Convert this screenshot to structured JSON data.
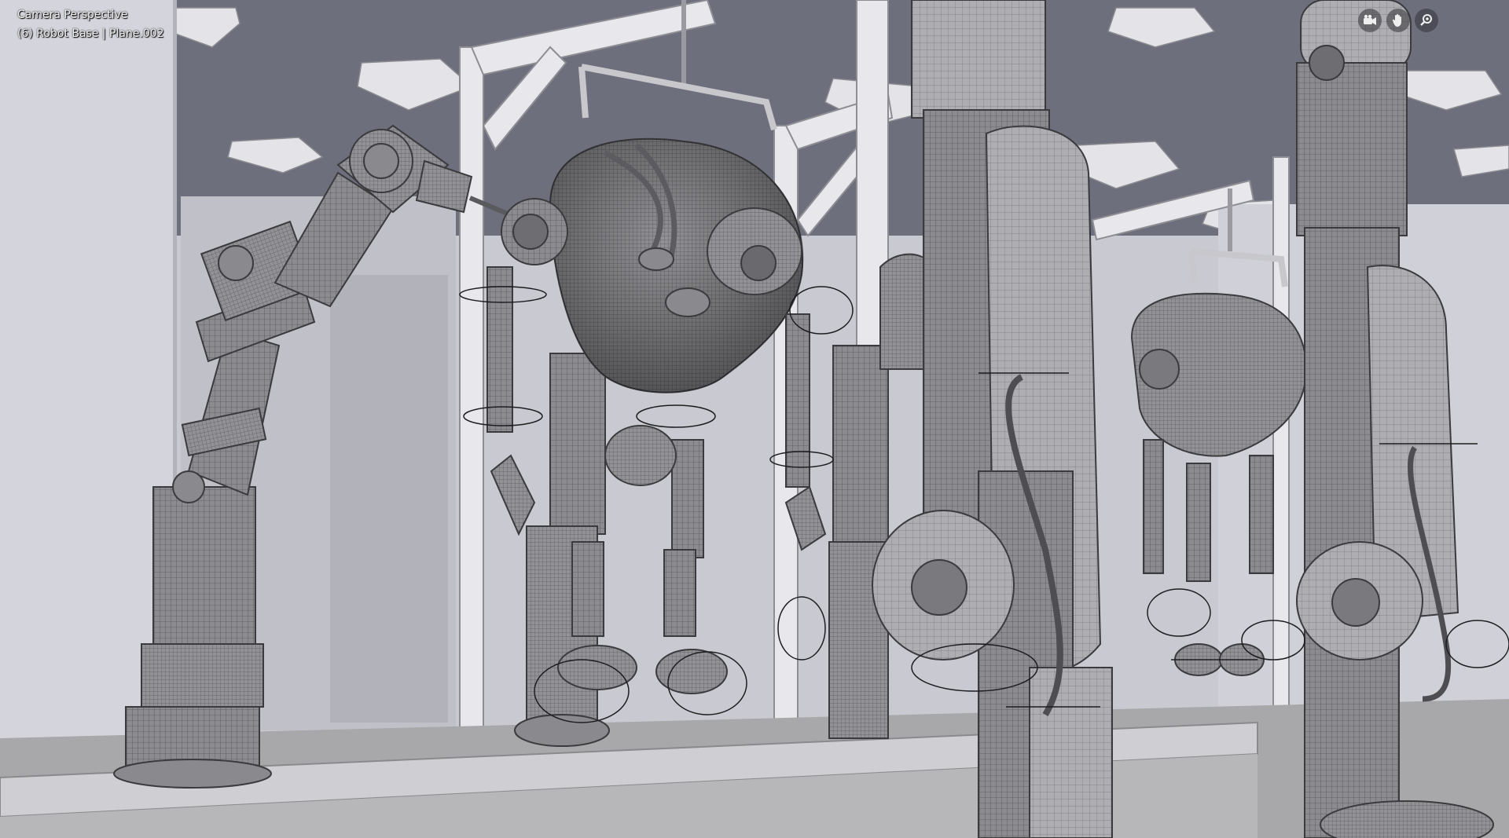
{
  "viewport": {
    "view_name": "Camera Perspective",
    "active_object": "(6) Robot Base | Plane.002",
    "shading": "wireframe-solid"
  },
  "navigation_gizmos": [
    {
      "name": "camera-view-icon",
      "label": "Toggle camera view"
    },
    {
      "name": "pan-hand-icon",
      "label": "Move view"
    },
    {
      "name": "zoom-icon",
      "label": "Zoom view"
    }
  ],
  "colors": {
    "ceiling": "#6d6f7d",
    "wall_light": "#d6d7de",
    "wall_mid": "#b9bac2",
    "mesh_dark": "#4a4a4d",
    "mesh_mid": "#8a8a8e",
    "mesh_light": "#b2b2b6",
    "floor": "#9d9d9f",
    "rig_line": "#1d1d1f"
  }
}
